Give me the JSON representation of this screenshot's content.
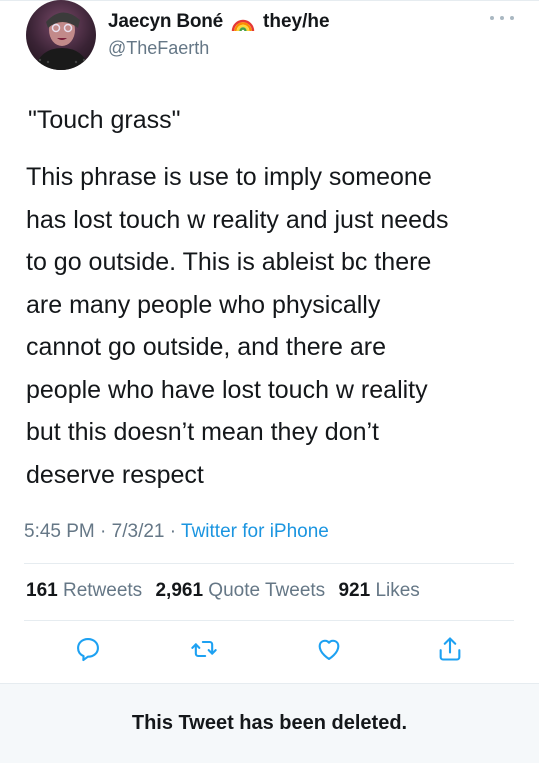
{
  "author": {
    "display_name": "Jaecyn Boné",
    "pronouns": "they/he",
    "handle": "@TheFaerth"
  },
  "tweet": {
    "quote_title": "\"Touch grass\"",
    "body_lines": [
      "This phrase is use to imply someone",
      "has lost touch w reality and just needs",
      "to go outside. This is ableist bc there",
      "are many people who physically",
      "cannot go outside, and there are",
      "people who have lost touch w reality",
      "but this doesn’t mean they don’t",
      "deserve respect"
    ],
    "time": "5:45 PM",
    "date": "7/3/21",
    "source": "Twitter for iPhone"
  },
  "stats": {
    "retweets_count": "161",
    "retweets_label": "Retweets",
    "quote_count": "2,961",
    "quote_label": "Quote Tweets",
    "likes_count": "921",
    "likes_label": "Likes"
  },
  "actions": [
    "reply-icon",
    "retweet-icon",
    "like-icon",
    "share-icon"
  ],
  "deleted_notice": "This Tweet has been deleted.",
  "colors": {
    "text": "#14171a",
    "secondary": "#657786",
    "link": "#1b95e0",
    "icon": "#1da1f2"
  }
}
